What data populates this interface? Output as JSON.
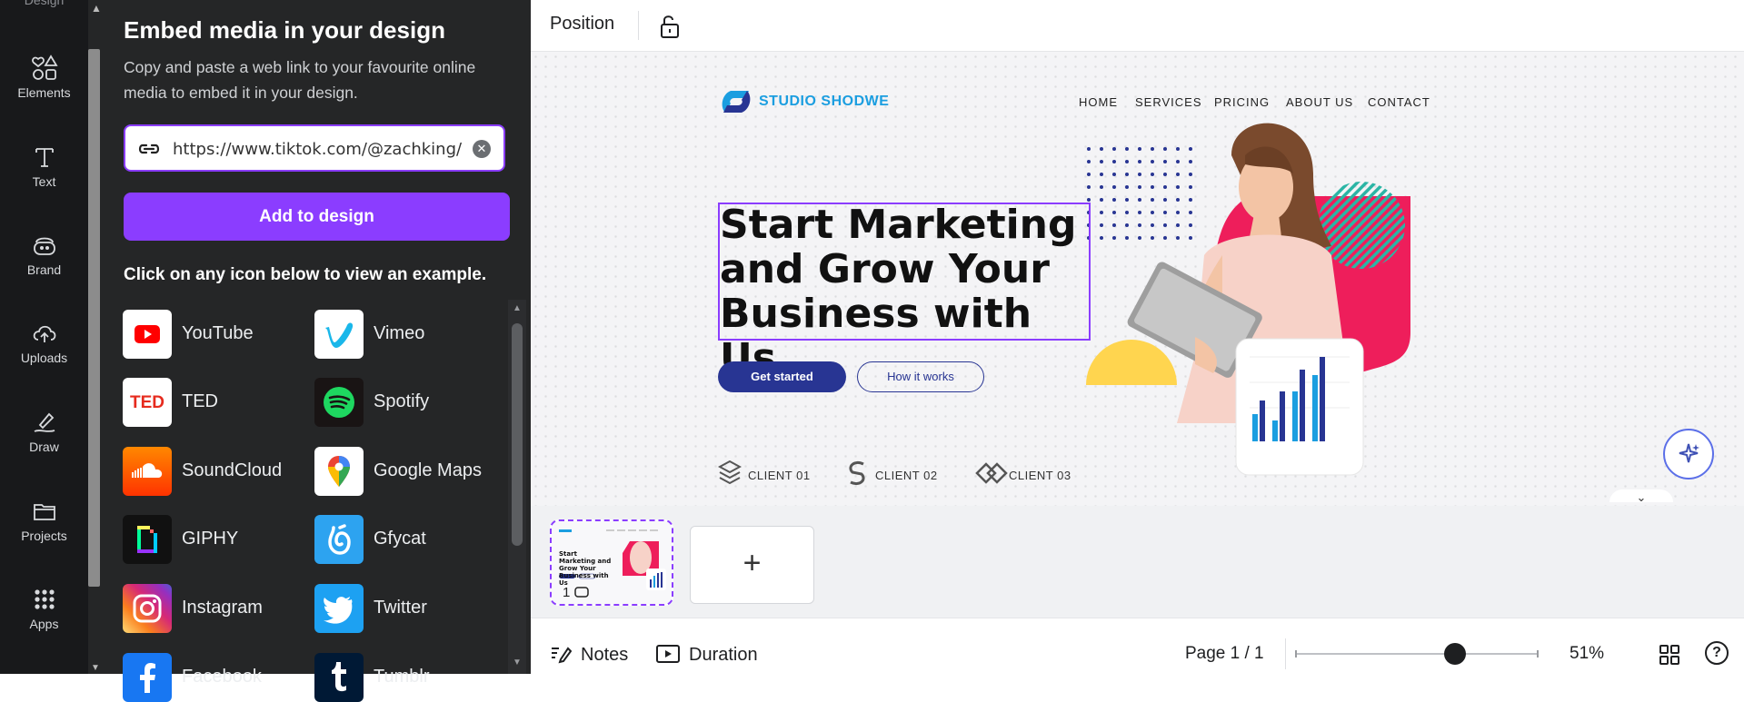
{
  "rail": {
    "top_label": "Design",
    "items": [
      {
        "label": "Elements",
        "icon": "elements-icon"
      },
      {
        "label": "Text",
        "icon": "text-icon"
      },
      {
        "label": "Brand",
        "icon": "brand-icon"
      },
      {
        "label": "Uploads",
        "icon": "uploads-icon"
      },
      {
        "label": "Draw",
        "icon": "draw-icon"
      },
      {
        "label": "Projects",
        "icon": "projects-icon"
      },
      {
        "label": "Apps",
        "icon": "apps-icon"
      }
    ]
  },
  "panel": {
    "title": "Embed media in your design",
    "description": "Copy and paste a web link to your favourite online media to embed it in your design.",
    "url_value": "https://www.tiktok.com/@zachking/",
    "add_button": "Add to design",
    "hint": "Click on any icon below to view an example.",
    "media": [
      {
        "name": "YouTube",
        "icon": "youtube-icon"
      },
      {
        "name": "Vimeo",
        "icon": "vimeo-icon"
      },
      {
        "name": "TED",
        "icon": "ted-icon"
      },
      {
        "name": "Spotify",
        "icon": "spotify-icon"
      },
      {
        "name": "SoundCloud",
        "icon": "soundcloud-icon"
      },
      {
        "name": "Google Maps",
        "icon": "google-maps-icon"
      },
      {
        "name": "GIPHY",
        "icon": "giphy-icon"
      },
      {
        "name": "Gfycat",
        "icon": "gfycat-icon"
      },
      {
        "name": "Instagram",
        "icon": "instagram-icon"
      },
      {
        "name": "Twitter",
        "icon": "twitter-icon"
      },
      {
        "name": "Facebook",
        "icon": "facebook-icon"
      },
      {
        "name": "Tumblr",
        "icon": "tumblr-icon"
      }
    ]
  },
  "toolbar": {
    "position_label": "Position"
  },
  "design": {
    "logo_text": "STUDIO SHODWE",
    "nav": [
      "HOME",
      "SERVICES",
      "PRICING",
      "ABOUT US",
      "CONTACT"
    ],
    "headline": "Start Marketing and Grow Your Business with Us",
    "cta_primary": "Get started",
    "cta_secondary": "How it works",
    "clients": [
      "CLIENT 01",
      "CLIENT 02",
      "CLIENT 03"
    ]
  },
  "thumbnail": {
    "headline": "Start Marketing and Grow Your Business with Us",
    "page_number": "1"
  },
  "bottom": {
    "notes": "Notes",
    "duration": "Duration",
    "page_indicator": "Page 1 / 1",
    "zoom": "51%",
    "help": "?"
  },
  "colors": {
    "accent_purple": "#8b3dff",
    "dark_navy": "#283593",
    "brand_blue": "#1b9ee0",
    "hero_pink": "#ee1e5b",
    "yellow": "#ffd54f",
    "teal": "#2bb5a5"
  }
}
